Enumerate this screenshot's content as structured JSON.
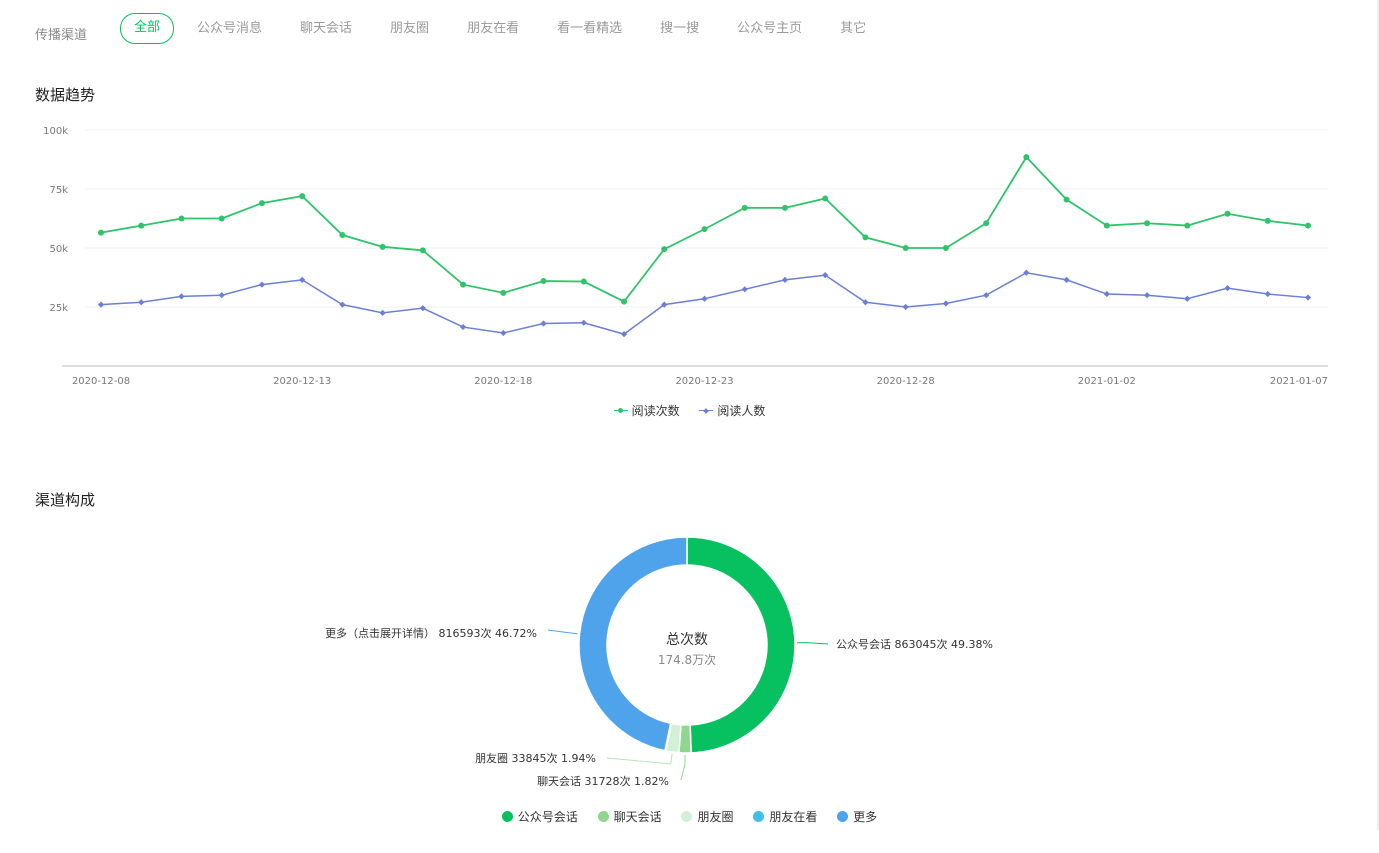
{
  "filter": {
    "label": "传播渠道",
    "tabs": [
      "全部",
      "公众号消息",
      "聊天会话",
      "朋友圈",
      "朋友在看",
      "看一看精选",
      "搜一搜",
      "公众号主页",
      "其它"
    ],
    "active_index": 0
  },
  "trend": {
    "title": "数据趋势"
  },
  "composition": {
    "title": "渠道构成",
    "center_title": "总次数",
    "center_value": "174.8万次"
  },
  "colors": {
    "accent": "#07c160",
    "series_views": "#2fc46a",
    "series_readers": "#6b7fd4",
    "slice_official": "#07c160",
    "slice_chat": "#8fd68f",
    "slice_moments": "#d2f0d3",
    "slice_friends_watching": "#3fc0e8",
    "slice_more": "#4fa3ea"
  },
  "chart_data": [
    {
      "type": "line",
      "x": [
        "2020-12-08",
        "2020-12-09",
        "2020-12-10",
        "2020-12-11",
        "2020-12-12",
        "2020-12-13",
        "2020-12-14",
        "2020-12-15",
        "2020-12-16",
        "2020-12-17",
        "2020-12-18",
        "2020-12-19",
        "2020-12-20",
        "2020-12-21",
        "2020-12-22",
        "2020-12-23",
        "2020-12-24",
        "2020-12-25",
        "2020-12-26",
        "2020-12-27",
        "2020-12-28",
        "2020-12-29",
        "2020-12-30",
        "2020-12-31",
        "2021-01-01",
        "2021-01-02",
        "2021-01-03",
        "2021-01-04",
        "2021-01-05",
        "2021-01-06",
        "2021-01-07"
      ],
      "x_tick_labels": [
        "2020-12-08",
        "2020-12-13",
        "2020-12-18",
        "2020-12-23",
        "2020-12-28",
        "2021-01-02",
        "2021-01-07"
      ],
      "y_ticks": [
        25000,
        50000,
        75000,
        100000
      ],
      "y_tick_labels": [
        "25k",
        "50k",
        "75k",
        "100k"
      ],
      "ylim": [
        0,
        100000
      ],
      "grid": true,
      "legend_position": "bottom-center",
      "series": [
        {
          "name": "阅读次数",
          "marker": "circle",
          "values": [
            56500,
            59500,
            62500,
            62500,
            69000,
            72000,
            55500,
            50500,
            49000,
            34500,
            31000,
            36000,
            35800,
            27300,
            49500,
            58000,
            67000,
            67000,
            71000,
            54500,
            50000,
            50000,
            60500,
            88500,
            70500,
            59500,
            60500,
            59500,
            64500,
            61500,
            59500
          ]
        },
        {
          "name": "阅读人数",
          "marker": "diamond",
          "values": [
            26000,
            27000,
            29500,
            30000,
            34500,
            36500,
            26000,
            22500,
            24500,
            16500,
            14000,
            18000,
            18300,
            13500,
            26000,
            28500,
            32500,
            36500,
            38500,
            27000,
            25000,
            26500,
            30000,
            39500,
            36500,
            30500,
            30000,
            28500,
            33000,
            30500,
            29000
          ]
        }
      ]
    },
    {
      "type": "pie",
      "donut": true,
      "legend_position": "bottom-center",
      "slices": [
        {
          "name": "公众号会话",
          "value": 863045,
          "percent": 49.38,
          "label": "公众号会话 863045次 49.38%"
        },
        {
          "name": "聊天会话",
          "value": 31728,
          "percent": 1.82,
          "label": "聊天会话 31728次 1.82%"
        },
        {
          "name": "朋友圈",
          "value": 33845,
          "percent": 1.94,
          "label": "朋友圈 33845次 1.94%"
        },
        {
          "name": "朋友在看",
          "value": 2538,
          "percent": 0.14,
          "label": ""
        },
        {
          "name": "更多",
          "value": 816593,
          "percent": 46.72,
          "label": "更多（点击展开详情） 816593次 46.72%"
        }
      ],
      "legend": [
        "公众号会话",
        "聊天会话",
        "朋友圈",
        "朋友在看",
        "更多"
      ]
    }
  ]
}
